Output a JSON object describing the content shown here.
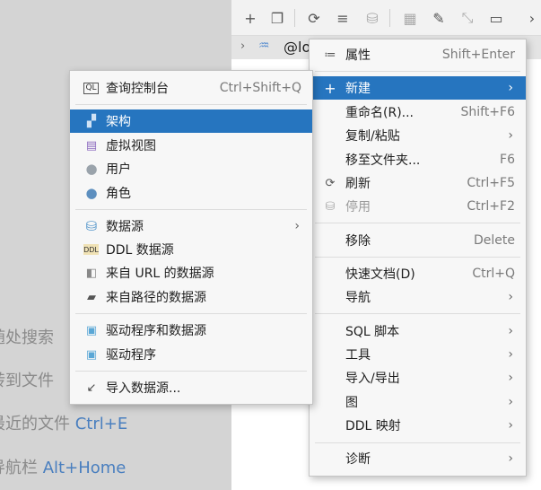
{
  "background": {
    "hints": [
      {
        "text": "随处搜索",
        "key": ""
      },
      {
        "text": "转到文件",
        "key": ""
      },
      {
        "text": "最近的文件 ",
        "key": "Ctrl+E"
      },
      {
        "text": "导航栏 ",
        "key": "Alt+Home"
      }
    ],
    "tree_row_label": "@lo"
  },
  "toolbar": {
    "icons": [
      "add-icon",
      "copy-icon",
      "refresh-icon",
      "schema-settings-icon",
      "database-icon",
      "table-icon",
      "edit-icon",
      "collapse-icon",
      "console-icon",
      "more-icon"
    ]
  },
  "new_submenu": {
    "items": [
      {
        "label": "查询控制台",
        "shortcut": "Ctrl+Shift+Q",
        "icon": "console-icon"
      },
      {
        "label": "架构",
        "shortcut": "",
        "icon": "schema-icon",
        "selected": true
      },
      {
        "label": "虚拟视图",
        "shortcut": "",
        "icon": "virtual-view-icon"
      },
      {
        "label": "用户",
        "shortcut": "",
        "icon": "user-icon"
      },
      {
        "label": "角色",
        "shortcut": "",
        "icon": "role-icon"
      },
      {
        "label": "数据源",
        "shortcut": "",
        "icon": "datasource-icon",
        "submenu": true
      },
      {
        "label": "DDL 数据源",
        "shortcut": "",
        "icon": "ddl-icon"
      },
      {
        "label": "来自 URL 的数据源",
        "shortcut": "",
        "icon": "url-icon"
      },
      {
        "label": "来自路径的数据源",
        "shortcut": "",
        "icon": "folder-icon"
      },
      {
        "label": "驱动程序和数据源",
        "shortcut": "",
        "icon": "driver-datasource-icon"
      },
      {
        "label": "驱动程序",
        "shortcut": "",
        "icon": "driver-icon"
      },
      {
        "label": "导入数据源...",
        "shortcut": "",
        "icon": "import-icon"
      }
    ]
  },
  "context_menu": {
    "items": [
      {
        "label": "属性",
        "shortcut": "Shift+Enter",
        "icon": "properties-icon"
      },
      {
        "label": "新建",
        "shortcut": "",
        "icon": "plus-icon",
        "submenu": true,
        "selected": true
      },
      {
        "label": "重命名(R)...",
        "shortcut": "Shift+F6"
      },
      {
        "label": "复制/粘贴",
        "shortcut": "",
        "submenu": true
      },
      {
        "label": "移至文件夹...",
        "shortcut": "F6"
      },
      {
        "label": "刷新",
        "shortcut": "Ctrl+F5",
        "icon": "refresh-icon"
      },
      {
        "label": "停用",
        "shortcut": "Ctrl+F2",
        "icon": "deactivate-icon",
        "disabled": true
      },
      {
        "label": "移除",
        "shortcut": "Delete"
      },
      {
        "label": "快速文档(D)",
        "shortcut": "Ctrl+Q"
      },
      {
        "label": "导航",
        "shortcut": "",
        "submenu": true
      },
      {
        "label": "SQL 脚本",
        "shortcut": "",
        "submenu": true
      },
      {
        "label": "工具",
        "shortcut": "",
        "submenu": true
      },
      {
        "label": "导入/导出",
        "shortcut": "",
        "submenu": true
      },
      {
        "label": "图",
        "shortcut": "",
        "submenu": true
      },
      {
        "label": "DDL 映射",
        "shortcut": "",
        "submenu": true
      },
      {
        "label": "诊断",
        "shortcut": "",
        "submenu": true
      }
    ]
  },
  "colors": {
    "selection": "#2675bf",
    "menu_bg": "#f7f7f7",
    "shortcut_text": "#7a7a7a",
    "hint_key": "#4a7fbf"
  }
}
